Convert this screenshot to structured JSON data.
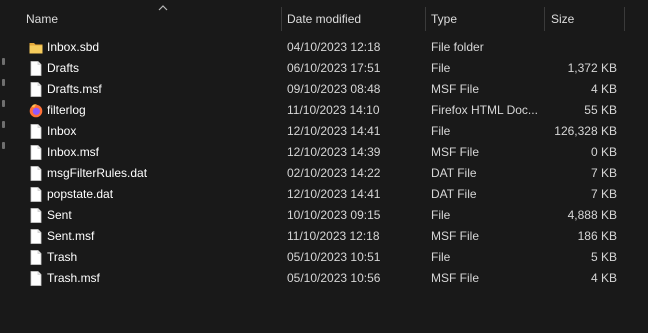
{
  "columns": {
    "name": "Name",
    "date": "Date modified",
    "type": "Type",
    "size": "Size"
  },
  "sort": {
    "column": "name",
    "direction": "ascending",
    "icon": "sort-up-arrow-icon"
  },
  "files": [
    {
      "name": "Inbox.sbd",
      "date": "04/10/2023 12:18",
      "type": "File folder",
      "size": "",
      "icon": "folder-icon"
    },
    {
      "name": "Drafts",
      "date": "06/10/2023 17:51",
      "type": "File",
      "size": "1,372 KB",
      "icon": "file-icon"
    },
    {
      "name": "Drafts.msf",
      "date": "09/10/2023 08:48",
      "type": "MSF File",
      "size": "4 KB",
      "icon": "file-icon"
    },
    {
      "name": "filterlog",
      "date": "11/10/2023 14:10",
      "type": "Firefox HTML Doc...",
      "size": "55 KB",
      "icon": "firefox-icon"
    },
    {
      "name": "Inbox",
      "date": "12/10/2023 14:41",
      "type": "File",
      "size": "126,328 KB",
      "icon": "file-icon"
    },
    {
      "name": "Inbox.msf",
      "date": "12/10/2023 14:39",
      "type": "MSF File",
      "size": "0 KB",
      "icon": "file-icon"
    },
    {
      "name": "msgFilterRules.dat",
      "date": "02/10/2023 14:22",
      "type": "DAT File",
      "size": "7 KB",
      "icon": "file-icon"
    },
    {
      "name": "popstate.dat",
      "date": "12/10/2023 14:41",
      "type": "DAT File",
      "size": "7 KB",
      "icon": "file-icon"
    },
    {
      "name": "Sent",
      "date": "10/10/2023 09:15",
      "type": "File",
      "size": "4,888 KB",
      "icon": "file-icon"
    },
    {
      "name": "Sent.msf",
      "date": "11/10/2023 12:18",
      "type": "MSF File",
      "size": "186 KB",
      "icon": "file-icon"
    },
    {
      "name": "Trash",
      "date": "05/10/2023 10:51",
      "type": "File",
      "size": "5 KB",
      "icon": "file-icon"
    },
    {
      "name": "Trash.msf",
      "date": "05/10/2023 10:56",
      "type": "MSF File",
      "size": "4 KB",
      "icon": "file-icon"
    }
  ],
  "colors": {
    "background": "#191919",
    "header_text": "#dcdcdc",
    "folder": "#f2c14e",
    "file_page": "#ffffff",
    "firefox_orange": "#ff7139",
    "firefox_purple": "#9059ff"
  }
}
